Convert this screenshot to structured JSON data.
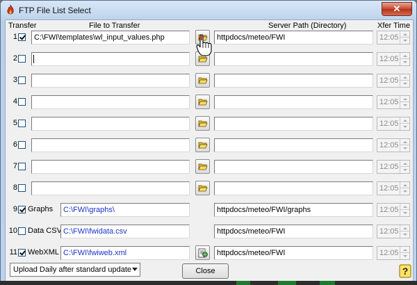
{
  "window": {
    "title": "FTP File List Select",
    "close_glyph": "✕"
  },
  "headers": {
    "transfer": "Transfer",
    "file": "File to Transfer",
    "server": "Server Path (Directory)",
    "xfer": "Xfer Time"
  },
  "rows": [
    {
      "num": "1",
      "checked": true,
      "label": "",
      "file": "C:\\FWI\\templates\\wl_input_values.php",
      "server": "httpdocs/meteo/FWI",
      "time": "12:05",
      "browse_icon": "folder-open-icon"
    },
    {
      "num": "2",
      "checked": false,
      "label": "",
      "file": "",
      "server": "",
      "time": "12:05",
      "browse_icon": "folder-open-icon"
    },
    {
      "num": "3",
      "checked": false,
      "label": "",
      "file": "",
      "server": "",
      "time": "12:05",
      "browse_icon": "folder-open-icon"
    },
    {
      "num": "4",
      "checked": false,
      "label": "",
      "file": "",
      "server": "",
      "time": "12:05",
      "browse_icon": "folder-open-icon"
    },
    {
      "num": "5",
      "checked": false,
      "label": "",
      "file": "",
      "server": "",
      "time": "12:05",
      "browse_icon": "folder-open-icon"
    },
    {
      "num": "6",
      "checked": false,
      "label": "",
      "file": "",
      "server": "",
      "time": "12:05",
      "browse_icon": "folder-open-icon"
    },
    {
      "num": "7",
      "checked": false,
      "label": "",
      "file": "",
      "server": "",
      "time": "12:05",
      "browse_icon": "folder-open-icon"
    },
    {
      "num": "8",
      "checked": false,
      "label": "",
      "file": "",
      "server": "",
      "time": "12:05",
      "browse_icon": "folder-open-icon"
    },
    {
      "num": "9",
      "checked": true,
      "label": "Graphs",
      "file": "C:\\FWI\\graphs\\",
      "server": "httpdocs/meteo/FWI/graphs",
      "time": "12:05",
      "browse_icon": ""
    },
    {
      "num": "10",
      "checked": false,
      "label": "Data CSV",
      "file": "C:\\FWI\\fwidata.csv",
      "server": "httpdocs/meteo/FWI",
      "time": "12:05",
      "browse_icon": ""
    },
    {
      "num": "11",
      "checked": true,
      "label": "WebXML",
      "file": "C:\\FWI\\fwiweb.xml",
      "server": "httpdocs/meteo/FWI",
      "time": "12:05",
      "browse_icon": "web-file-icon"
    }
  ],
  "footer": {
    "schedule_value": "Upload Daily after standard update",
    "close_label": "Close",
    "help_icon": "help-question-icon"
  },
  "colors": {
    "accent_text": "#1a33c9",
    "title_close": "#c7472e"
  }
}
